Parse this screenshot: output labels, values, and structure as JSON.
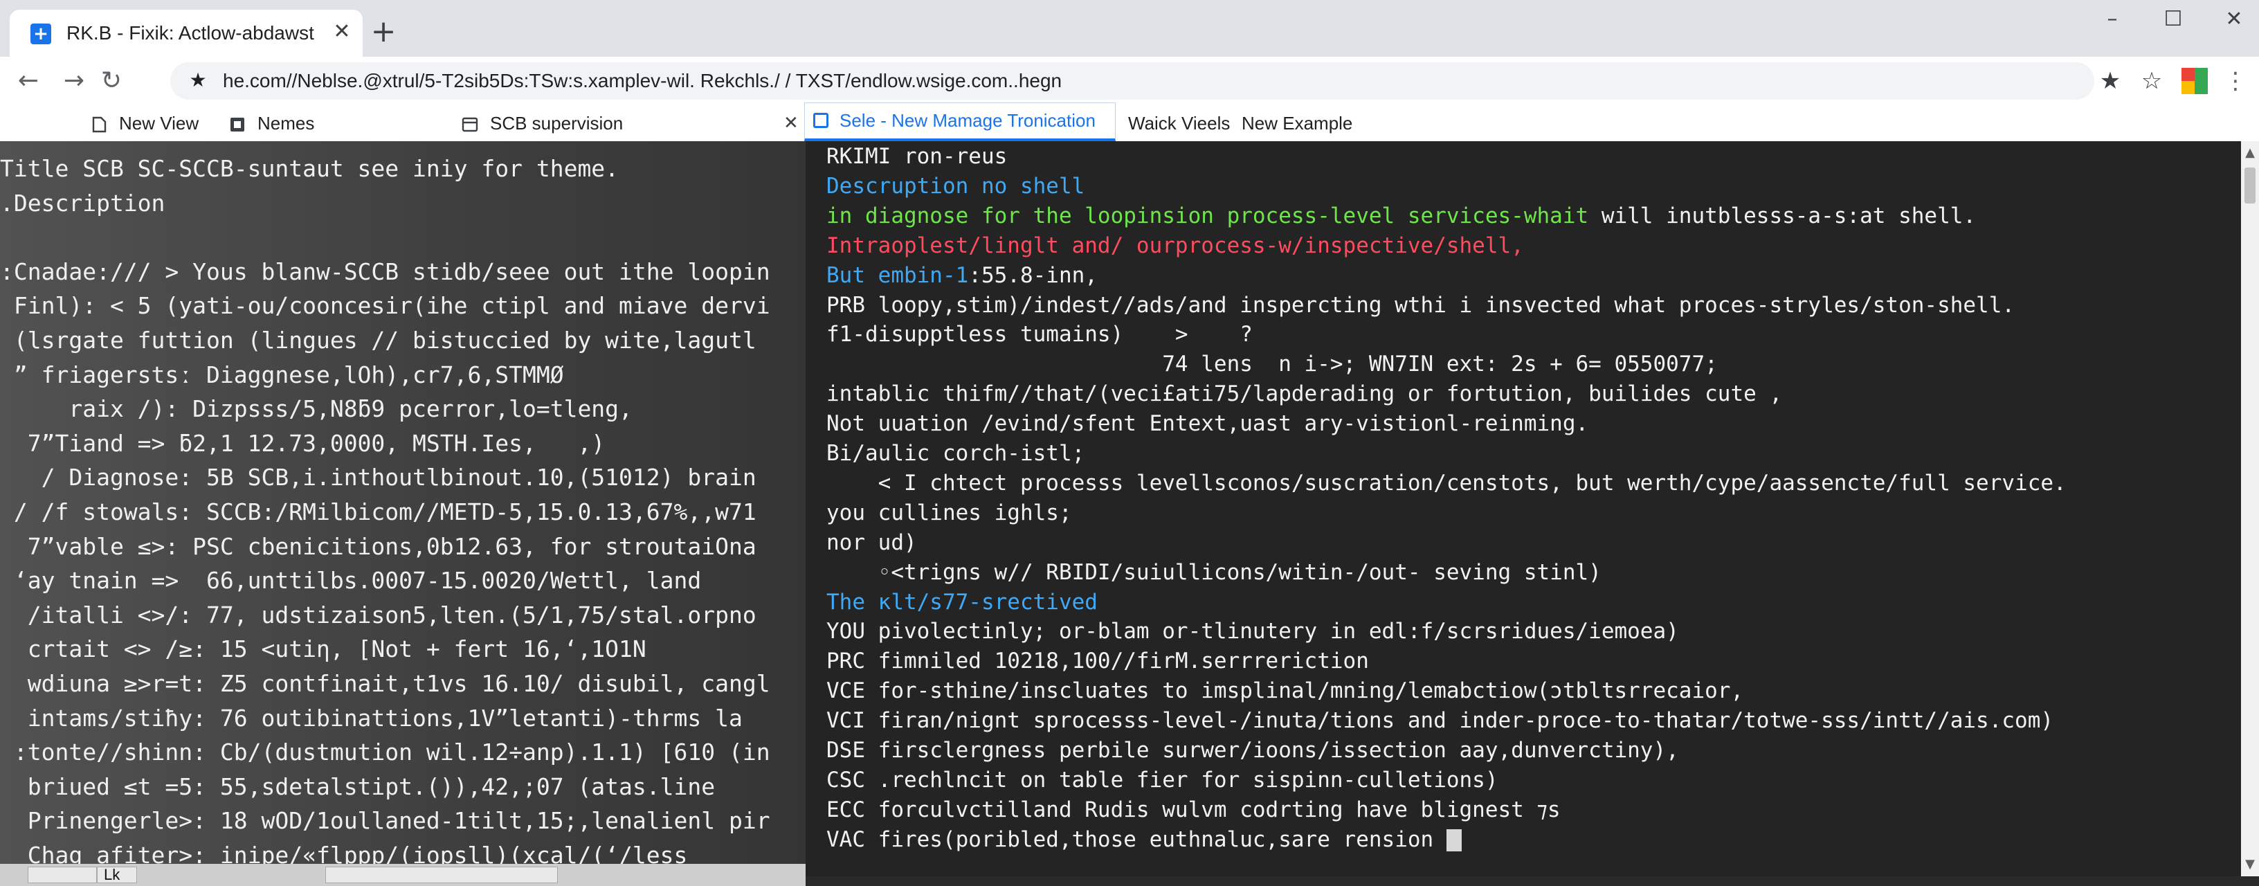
{
  "browser": {
    "tab_title": "RK.B - Fixik: Actlow-abdawst",
    "tab_favicon": "+",
    "close_glyph": "✕",
    "new_tab_glyph": "+",
    "window_controls": [
      "–",
      "☐",
      "✕"
    ],
    "url": "he.com//Neblse.@xtrul/5-T2sib5Ds:TSw:s.xamplev-wil. Rekchls./ / TXST/endlow.wsige.com..hegn",
    "icons": {
      "favicon": "plus-square-icon",
      "back": "arrow-left-icon",
      "forward": "arrow-right-icon",
      "reload": "reload-icon",
      "site_info": "star-icon",
      "bookmark": "star-outline-icon",
      "extension": "extension-icon",
      "menu": "more-vert-icon"
    },
    "extension_colors": [
      "#ea4335",
      "#34a853",
      "#fbbc04",
      "#34a853"
    ]
  },
  "bookmarks": {
    "items": [
      {
        "label": "New View",
        "icon": "page-icon"
      },
      {
        "label": "Nemes",
        "icon": "bookmark-icon"
      },
      {
        "label": "SCB supervision",
        "icon": "folder-icon"
      }
    ],
    "close_glyph": "✕",
    "active_tab": {
      "label": "Sele - New Mamage  Tronication",
      "icon": "square-icon"
    },
    "after": [
      {
        "label": "Waick Vieels"
      },
      {
        "label": "New Example"
      }
    ]
  },
  "left_console": {
    "lines": [
      "Title SCB SC-SCCB-suntaut see iniy for theme.",
      ".Description",
      "",
      ":Cnadae:/// > Yous blanw-SCCB stidb/seee out ithe loopin",
      " Finl): < 5 (yati-ou/cooncesir(ihe ctipl and miave dervi",
      " (lsrgate futtion (lingues // bistuccied by wite,lagutl",
      " ” friagerstsː Diaggnese,lOh),cr7,6,STMMØ",
      "     raix /): Dizpsss/5,N8ƃ9 pcerror,lo=tleng,",
      "  7”Tiand => ƃ2,1 12.73,0000, MSTH.Ies,   ,)",
      "   / Diagnose: 5B SCB,i.inthoutlbinout.10,(51012) brain",
      " / /f stowals: SCCB:/RMilbicom//METD-5,15.0.13,67%,,w71",
      "  7”vable ≤>: PSC cbenicitions,0b12.63, for stroutaiOna",
      " ‘ay tnain =>  66,unttilbs.0007-15.0020/Wettl, land",
      "  /italli <>/: 77, udstizaison5,lten.(5/1,75/stal.orpno",
      "  crtait <> /≥: 15 <utiƞ, [Not + fert 16,ʻ,1O1N",
      "  wdiuna ≥>r=t: Z5 contfinait,t1vs 16.10/ disubil, cangl",
      "  intams/stiħy: 76 outibinattions,1V”letanti)-thrms la",
      " :tonte//shinn: Cb/(dustmution wil.12÷anp).1.1) [610 (in",
      "  briued ≤t =5: 55,sdetalstipt.()),42,;07 (atas.line",
      "  Prinengerle>: 18 wOD/1oullaned-1tilt,15;,lenalienl pir",
      "  Chag afiter>: inipe/«flppp/(iopsll)(xcal/(ʻ/less"
    ]
  },
  "terminal": {
    "lines": [
      {
        "text": "RKIMI ron-reus",
        "color": ""
      },
      {
        "text": "Descruption no shell",
        "color": "cyan"
      },
      {
        "text": "in diagnose for the loopinsion process-level services-whait",
        "color": "green",
        "rest": " will inutblesss-a-s:at shell."
      },
      {
        "text": "Intraoplest/linglt and/ ourprocess-w/inspective/shell,",
        "color": "red"
      },
      {
        "text": "But embin-1",
        "color": "cyan",
        "rest": ":55.8-inn,"
      },
      {
        "text": "PRB loopy,stim)/indest//ads/and inspercting wthi i insvected what proces-stryles/ston-shell.",
        "color": ""
      },
      {
        "text": "f1-disupptless tumains)    >    ?",
        "color": ""
      },
      {
        "text": "                          74 lens  n i->; WN7IN ext: 2s + 6= 0550077;",
        "color": ""
      },
      {
        "text": "intablic thifm//that/(veci£ati75/lapderading or fortution, builides cute ,",
        "color": ""
      },
      {
        "text": "Not uuation /evind/sfent Entext,uast ary-vistionl-reinming.",
        "color": ""
      },
      {
        "text": "Bi/aulic corch-istl;",
        "color": ""
      },
      {
        "text": "    < I chtect processs levellsconos/suscration/censtots, but werth/cype/aassencte/full service.",
        "color": ""
      },
      {
        "text": "you cullines ighls;",
        "color": ""
      },
      {
        "text": "nor ud)",
        "color": ""
      },
      {
        "text": "    ◦<trigns w// RBIDI/suiullicons/witin-/out- seving stinl)",
        "color": ""
      },
      {
        "text": "The κlt/s77-srectived",
        "color": "cyan"
      },
      {
        "text": "YOU pivolectinly; or-blam or-tlinutery in edl:f/scrsridues/iemoea)",
        "color": ""
      },
      {
        "text": "PRC fimniled 10218,100//firM.serrreriction",
        "color": ""
      },
      {
        "text": "VCE for-sthine/inscluates to imsplinal/mning/lemabctiow(ɔtbltsrrecaior,",
        "color": ""
      },
      {
        "text": "VCI firan/nignt sprocesss-level-/inuta/tions and inder-proce-to-thatar/totwe-sss/intt//ais.com)",
        "color": ""
      },
      {
        "text": "DSE firsclergness perbile surwer/ioons/issection aay,dunverctiny),",
        "color": ""
      },
      {
        "text": "CSC .rechlncit on table fier for sispinn-culletions)",
        "color": ""
      },
      {
        "text": "ECC forculvctilland Rudis wulvm codrting have blignest ⁊s",
        "color": ""
      },
      {
        "text": "VAC fires(poribled,those euthnaluc,sare rension ",
        "color": "",
        "cursor": true
      }
    ]
  },
  "scrollbar": {
    "h_label": "Lk",
    "up_glyph": "▲",
    "down_glyph": "▼"
  }
}
